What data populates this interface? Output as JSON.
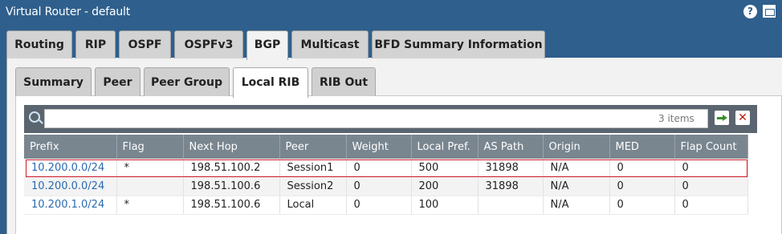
{
  "window": {
    "title": "Virtual Router - default"
  },
  "outer_tabs": [
    {
      "label": "Routing"
    },
    {
      "label": "RIP"
    },
    {
      "label": "OSPF"
    },
    {
      "label": "OSPFv3"
    },
    {
      "label": "BGP"
    },
    {
      "label": "Multicast"
    },
    {
      "label": "BFD Summary Information"
    }
  ],
  "outer_active": "BGP",
  "inner_tabs": [
    {
      "label": "Summary"
    },
    {
      "label": "Peer"
    },
    {
      "label": "Peer Group"
    },
    {
      "label": "Local RIB"
    },
    {
      "label": "RIB Out"
    }
  ],
  "inner_active": "Local RIB",
  "search": {
    "placeholder": "",
    "items_count": "3 items"
  },
  "table": {
    "columns": [
      "Prefix",
      "Flag",
      "Next Hop",
      "Peer",
      "Weight",
      "Local Pref.",
      "AS Path",
      "Origin",
      "MED",
      "Flap Count"
    ],
    "rows": [
      [
        "10.200.0.0/24",
        "*",
        "198.51.100.2",
        "Session1",
        "0",
        "500",
        "31898",
        "N/A",
        "0",
        "0"
      ],
      [
        "10.200.0.0/24",
        "",
        "198.51.100.6",
        "Session2",
        "0",
        "200",
        "31898",
        "N/A",
        "0",
        "0"
      ],
      [
        "10.200.1.0/24",
        "*",
        "198.51.100.6",
        "Local",
        "0",
        "100",
        "",
        "N/A",
        "0",
        "0"
      ]
    ],
    "highlighted_row": 0
  },
  "colors": {
    "header_bg": "#2f5f8c",
    "highlight_border": "#d11a2a",
    "link": "#2a6ab0"
  }
}
